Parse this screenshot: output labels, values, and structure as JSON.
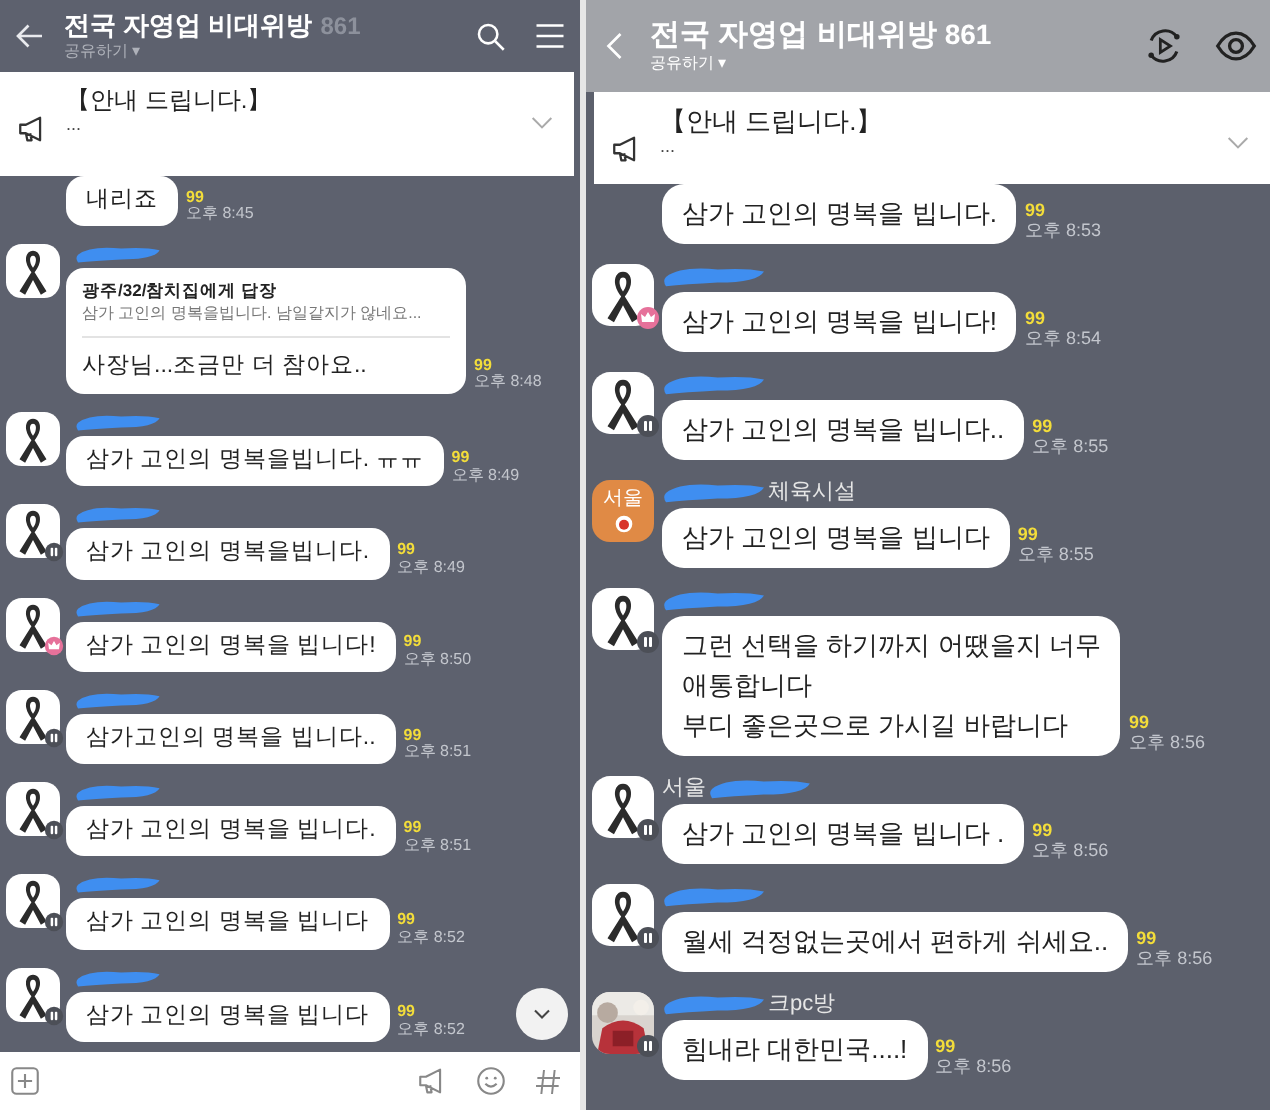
{
  "panels": [
    {
      "header": {
        "dimmed": false,
        "title": "전국 자영업 비대위방",
        "member_count": "861",
        "subtitle": "공유하기 ▾"
      },
      "notice": {
        "title": "【안내 드립니다.】",
        "body": "...",
        "expanded": false
      },
      "messages": [
        {
          "kind": "continued",
          "text": "내리죠",
          "unread": "99",
          "time": "오후 8:45"
        },
        {
          "kind": "reply",
          "avatar": {
            "kind": "ribbon"
          },
          "name_redacted": true,
          "reply_to": "광주/32/참치집에게 답장",
          "quote": "삼가 고인의 명복을빕니다. 남일같지가 않네요...",
          "text": "사장님...조금만 더 참아요..",
          "unread": "99",
          "time": "오후 8:48"
        },
        {
          "kind": "text",
          "avatar": {
            "kind": "ribbon"
          },
          "name_redacted": true,
          "text": "삼가 고인의 명복을빕니다. ㅠㅠ",
          "unread": "99",
          "time": "오후 8:49"
        },
        {
          "kind": "text",
          "avatar": {
            "kind": "ribbon"
          },
          "badge": {
            "kind": "member"
          },
          "name_redacted": true,
          "text": "삼가 고인의 명복을빕니다.",
          "unread": "99",
          "time": "오후 8:49"
        },
        {
          "kind": "text",
          "avatar": {
            "kind": "ribbon"
          },
          "badge": {
            "kind": "crown"
          },
          "name_redacted": true,
          "text": "삼가 고인의 명복을 빕니다!",
          "unread": "99",
          "time": "오후 8:50"
        },
        {
          "kind": "text",
          "avatar": {
            "kind": "ribbon"
          },
          "badge": {
            "kind": "member"
          },
          "name_redacted": true,
          "text": "삼가고인의 명복을 빕니다..",
          "unread": "99",
          "time": "오후 8:51"
        },
        {
          "kind": "text",
          "avatar": {
            "kind": "ribbon"
          },
          "badge": {
            "kind": "member"
          },
          "name_redacted": true,
          "text": "삼가 고인의 명복을 빕니다.",
          "unread": "99",
          "time": "오후 8:51"
        },
        {
          "kind": "text",
          "avatar": {
            "kind": "ribbon"
          },
          "badge": {
            "kind": "member"
          },
          "name_redacted": true,
          "text": "삼가 고인의 명복을 빕니다",
          "unread": "99",
          "time": "오후 8:52"
        },
        {
          "kind": "text",
          "avatar": {
            "kind": "ribbon"
          },
          "badge": {
            "kind": "member"
          },
          "name_redacted": true,
          "text": "삼가 고인의 명복을 빕니다",
          "unread": "99",
          "time": "오후 8:52"
        }
      ],
      "scroll_down_button": true,
      "input_bar": true
    },
    {
      "header": {
        "dimmed": true,
        "title": "전국 자영업 비대위방",
        "member_count": "861",
        "subtitle": "공유하기 ▾"
      },
      "notice": {
        "title": "【안내 드립니다.】",
        "body": "...",
        "expanded": false
      },
      "messages": [
        {
          "kind": "continued",
          "text": "삼가 고인의 명복을 빕니다.",
          "unread": "99",
          "time": "오후 8:53"
        },
        {
          "kind": "text",
          "avatar": {
            "kind": "ribbon"
          },
          "badge": {
            "kind": "crown"
          },
          "name_redacted": true,
          "text": "삼가 고인의 명복을 빕니다!",
          "unread": "99",
          "time": "오후 8:54"
        },
        {
          "kind": "text",
          "avatar": {
            "kind": "ribbon"
          },
          "badge": {
            "kind": "member"
          },
          "name_redacted": true,
          "text": "삼가 고인의 명복을 빕니다..",
          "unread": "99",
          "time": "오후 8:55"
        },
        {
          "kind": "text",
          "avatar": {
            "kind": "city",
            "text": "서울"
          },
          "name_redacted": true,
          "name": "체육시설",
          "text": "삼가 고인의 명복을 빕니다",
          "unread": "99",
          "time": "오후 8:55"
        },
        {
          "kind": "text",
          "avatar": {
            "kind": "ribbon"
          },
          "badge": {
            "kind": "member"
          },
          "name_redacted": true,
          "text": "그런 선택을 하기까지 어땠을지 너무\n애통합니다\n부디 좋은곳으로 가시길 바랍니다",
          "unread": "99",
          "time": "오후 8:56"
        },
        {
          "kind": "text",
          "avatar": {
            "kind": "ribbon"
          },
          "badge": {
            "kind": "member"
          },
          "name_prefix": "서울",
          "name_redacted": true,
          "text": "삼가 고인의 명복을 빕니다 .",
          "unread": "99",
          "time": "오후 8:56"
        },
        {
          "kind": "text",
          "avatar": {
            "kind": "ribbon"
          },
          "badge": {
            "kind": "member"
          },
          "name_redacted": true,
          "text": "월세 걱정없는곳에서 편하게 쉬세요..",
          "unread": "99",
          "time": "오후 8:56"
        },
        {
          "kind": "text",
          "badge": {
            "kind": "member"
          },
          "name_redacted": true,
          "name": "크pc방",
          "text": "힘내라 대한민국....!",
          "unread": "99",
          "time": "오후 8:56"
        }
      ]
    }
  ]
}
